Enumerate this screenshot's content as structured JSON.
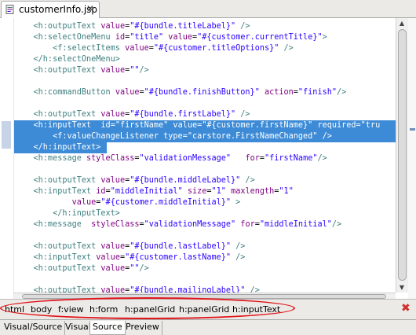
{
  "editor_tab": {
    "title": "customerInfo.jsp",
    "close": "✕",
    "icon": "jsp-file-icon"
  },
  "code_lines": [
    [
      {
        "c": "t",
        "s": "    <h:outputText "
      },
      {
        "c": "a",
        "s": "value"
      },
      {
        "c": "p",
        "s": "="
      },
      {
        "c": "v",
        "s": "\"#{bundle.titleLabel}\""
      },
      {
        "c": "t",
        "s": " />"
      }
    ],
    [
      {
        "c": "t",
        "s": "    <h:selectOneMenu "
      },
      {
        "c": "a",
        "s": "id"
      },
      {
        "c": "p",
        "s": "="
      },
      {
        "c": "v",
        "s": "\"title\""
      },
      {
        "c": "a",
        "s": " value"
      },
      {
        "c": "p",
        "s": "="
      },
      {
        "c": "v",
        "s": "\"#{customer.currentTitle}\""
      },
      {
        "c": "t",
        "s": ">"
      }
    ],
    [
      {
        "c": "t",
        "s": "        <f:selectItems "
      },
      {
        "c": "a",
        "s": "value"
      },
      {
        "c": "p",
        "s": "="
      },
      {
        "c": "v",
        "s": "\"#{customer.titleOptions}\""
      },
      {
        "c": "t",
        "s": " />"
      }
    ],
    [
      {
        "c": "t",
        "s": "    </h:selectOneMenu>"
      }
    ],
    [
      {
        "c": "t",
        "s": "    <h:outputText "
      },
      {
        "c": "a",
        "s": "value"
      },
      {
        "c": "p",
        "s": "="
      },
      {
        "c": "v",
        "s": "\"\""
      },
      {
        "c": "t",
        "s": "/>"
      }
    ],
    [],
    [
      {
        "c": "t",
        "s": "    <h:commandButton "
      },
      {
        "c": "a",
        "s": "value"
      },
      {
        "c": "p",
        "s": "="
      },
      {
        "c": "v",
        "s": "\"#{bundle.finishButton}\""
      },
      {
        "c": "a",
        "s": " action"
      },
      {
        "c": "p",
        "s": "="
      },
      {
        "c": "v",
        "s": "\"finish\""
      },
      {
        "c": "t",
        "s": "/>"
      }
    ],
    [],
    [
      {
        "c": "t",
        "s": "    <h:outputText "
      },
      {
        "c": "a",
        "s": "value"
      },
      {
        "c": "p",
        "s": "="
      },
      {
        "c": "v",
        "s": "\"#{bundle.firstLabel}\""
      },
      {
        "c": "t",
        "s": " />"
      }
    ],
    [
      {
        "c": "t",
        "s": "    <h:inputText  "
      },
      {
        "c": "a",
        "s": "id"
      },
      {
        "c": "p",
        "s": "="
      },
      {
        "c": "v",
        "s": "\"firstName\""
      },
      {
        "c": "a",
        "s": " value"
      },
      {
        "c": "p",
        "s": "="
      },
      {
        "c": "v",
        "s": "\"#{customer.firstName}\""
      },
      {
        "c": "a",
        "s": " required"
      },
      {
        "c": "p",
        "s": "="
      },
      {
        "c": "v",
        "s": "\"tru"
      }
    ],
    [
      {
        "c": "t",
        "s": "        <f:valueChangeListener "
      },
      {
        "c": "a",
        "s": "type"
      },
      {
        "c": "p",
        "s": "="
      },
      {
        "c": "v",
        "s": "\"carstore.FirstNameChanged\""
      },
      {
        "c": "t",
        "s": " />"
      }
    ],
    [
      {
        "c": "t",
        "s": "    </h:inputText>"
      }
    ],
    [
      {
        "c": "t",
        "s": "    <h:message "
      },
      {
        "c": "a",
        "s": "styleClass"
      },
      {
        "c": "p",
        "s": "="
      },
      {
        "c": "v",
        "s": "\"validationMessage\""
      },
      {
        "c": "a",
        "s": "   for"
      },
      {
        "c": "p",
        "s": "="
      },
      {
        "c": "v",
        "s": "\"firstName\""
      },
      {
        "c": "t",
        "s": "/>"
      }
    ],
    [],
    [
      {
        "c": "t",
        "s": "    <h:outputText "
      },
      {
        "c": "a",
        "s": "value"
      },
      {
        "c": "p",
        "s": "="
      },
      {
        "c": "v",
        "s": "\"#{bundle.middleLabel}\""
      },
      {
        "c": "t",
        "s": " />"
      }
    ],
    [
      {
        "c": "t",
        "s": "    <h:inputText "
      },
      {
        "c": "a",
        "s": "id"
      },
      {
        "c": "p",
        "s": "="
      },
      {
        "c": "v",
        "s": "\"middleInitial\""
      },
      {
        "c": "a",
        "s": " size"
      },
      {
        "c": "p",
        "s": "="
      },
      {
        "c": "v",
        "s": "\"1\""
      },
      {
        "c": "a",
        "s": " maxlength"
      },
      {
        "c": "p",
        "s": "="
      },
      {
        "c": "v",
        "s": "\"1\""
      }
    ],
    [
      {
        "c": "a",
        "s": "            value"
      },
      {
        "c": "p",
        "s": "="
      },
      {
        "c": "v",
        "s": "\"#{customer.middleInitial}\""
      },
      {
        "c": "t",
        "s": " >"
      }
    ],
    [
      {
        "c": "t",
        "s": "        </h:inputText>"
      }
    ],
    [
      {
        "c": "t",
        "s": "    <h:message  "
      },
      {
        "c": "a",
        "s": "styleClass"
      },
      {
        "c": "p",
        "s": "="
      },
      {
        "c": "v",
        "s": "\"validationMessage\""
      },
      {
        "c": "a",
        "s": " for"
      },
      {
        "c": "p",
        "s": "="
      },
      {
        "c": "v",
        "s": "\"middleInitial\""
      },
      {
        "c": "t",
        "s": "/>"
      }
    ],
    [],
    [
      {
        "c": "t",
        "s": "    <h:outputText "
      },
      {
        "c": "a",
        "s": "value"
      },
      {
        "c": "p",
        "s": "="
      },
      {
        "c": "v",
        "s": "\"#{bundle.lastLabel}\""
      },
      {
        "c": "t",
        "s": " />"
      }
    ],
    [
      {
        "c": "t",
        "s": "    <h:inputText "
      },
      {
        "c": "a",
        "s": "value"
      },
      {
        "c": "p",
        "s": "="
      },
      {
        "c": "v",
        "s": "\"#{customer.lastName}\""
      },
      {
        "c": "t",
        "s": " />"
      }
    ],
    [
      {
        "c": "t",
        "s": "    <h:outputText "
      },
      {
        "c": "a",
        "s": "value"
      },
      {
        "c": "p",
        "s": "="
      },
      {
        "c": "v",
        "s": "\"\""
      },
      {
        "c": "t",
        "s": "/>"
      }
    ],
    [],
    [
      {
        "c": "t",
        "s": "    <h:outputText "
      },
      {
        "c": "a",
        "s": "value"
      },
      {
        "c": "p",
        "s": "="
      },
      {
        "c": "v",
        "s": "\"#{bundle.mailingLabel}\""
      },
      {
        "c": "t",
        "s": " />"
      }
    ]
  ],
  "selected_lines": [
    9,
    10,
    11
  ],
  "breadcrumbs": [
    "html",
    "body",
    "f:view",
    "h:form",
    "h:panelGrid",
    "h:panelGrid",
    "h:inputText"
  ],
  "breadcrumb_close": "✖",
  "bottom_tabs": [
    "Visual/Source",
    "Visual",
    "Source",
    "Preview"
  ],
  "active_bottom_tab": 2,
  "colors": {
    "tag": "#3f7f7f",
    "attribute": "#7f007f",
    "value": "#2a00ff",
    "selection": "#3d8bd6",
    "highlight_ellipse": "#e0141b"
  }
}
